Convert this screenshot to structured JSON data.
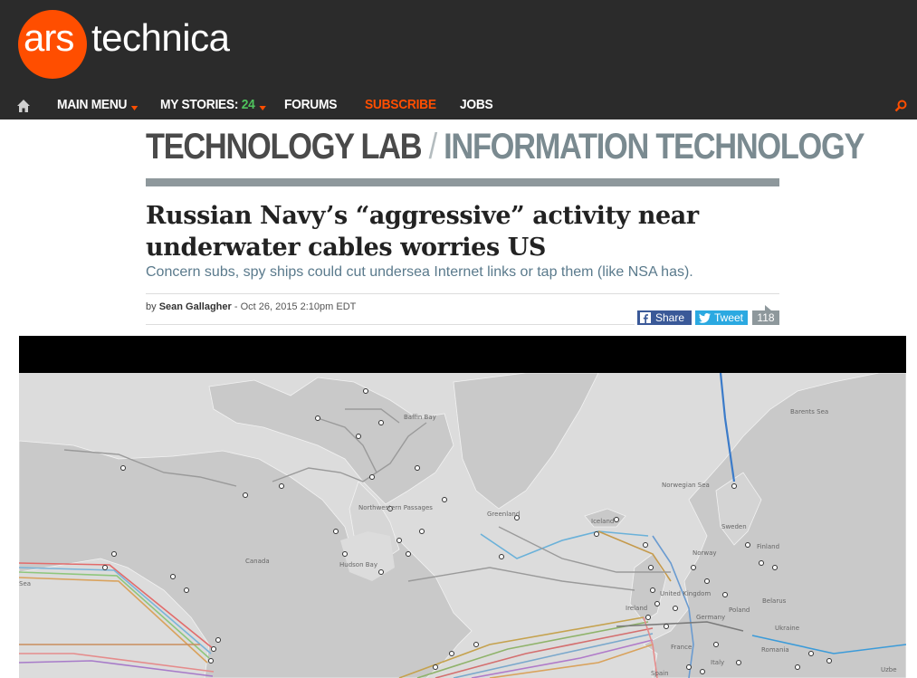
{
  "brand": {
    "logo_left": "ars",
    "logo_right": "technica"
  },
  "nav": {
    "main_menu": "MAIN MENU",
    "my_stories_label": "MY STORIES:",
    "my_stories_count": "24",
    "forums": "FORUMS",
    "subscribe": "SUBSCRIBE",
    "jobs": "JOBS"
  },
  "section": {
    "lab": "TECHNOLOGY LAB",
    "separator": "/",
    "category": "INFORMATION TECHNOLOGY"
  },
  "article": {
    "title_line1": "Russian Navy’s “aggressive” activity near",
    "title_line2": "underwater cables worries US",
    "subtitle": "Concern subs, spy ships could cut undersea Internet links or tap them (like NSA has).",
    "byline_prefix": "by",
    "author": "Sean Gallagher",
    "date": "- Oct 26, 2015 2:10pm EDT"
  },
  "share": {
    "facebook": "Share",
    "twitter": "Tweet",
    "comments": "118"
  },
  "map": {
    "labels": {
      "baffin_bay": "Baffin Bay",
      "barents_sea": "Barents Sea",
      "norwegian_sea": "Norwegian Sea",
      "greenland": "Greenland",
      "iceland": "Iceland",
      "canada": "Canada",
      "northwestern_passages": "Northwestern Passages",
      "hudson_bay": "Hudson Bay",
      "sea": "Sea",
      "sweden": "Sweden",
      "norway": "Norway",
      "finland": "Finland",
      "united_kingdom": "United Kingdom",
      "ireland": "Ireland",
      "germany": "Germany",
      "poland": "Poland",
      "belarus": "Belarus",
      "ukraine": "Ukraine",
      "france": "France",
      "romania": "Romania",
      "italy": "Italy",
      "spain": "Spain",
      "uzbe": "Uzbe"
    }
  },
  "colors": {
    "header_bg": "#2b2b2b",
    "brand_orange": "#ff4e00",
    "count_green": "#4fc35d",
    "facebook_blue": "#3a5998",
    "twitter_blue": "#2ba9e1",
    "section_gray": "#8e989c"
  }
}
